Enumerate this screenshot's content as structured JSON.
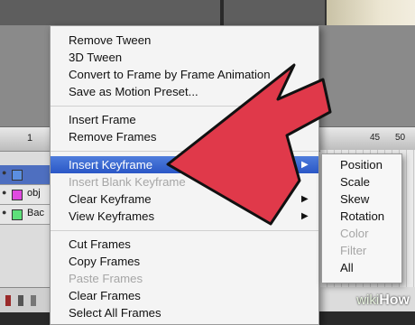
{
  "timeline": {
    "header_label": "1",
    "right_numbers": [
      "45",
      "50"
    ],
    "layers": [
      {
        "name": "",
        "color": "#5b8fe0",
        "selected": true
      },
      {
        "name": "obj",
        "color": "#e04ae0",
        "selected": false
      },
      {
        "name": "Bac",
        "color": "#5ee07a",
        "selected": false
      }
    ]
  },
  "context_menu": {
    "groups": [
      [
        {
          "label": "Remove Tween",
          "enabled": true
        },
        {
          "label": "3D Tween",
          "enabled": true
        },
        {
          "label": "Convert to Frame by Frame Animation",
          "enabled": true
        },
        {
          "label": "Save as Motion Preset...",
          "enabled": true
        }
      ],
      [
        {
          "label": "Insert Frame",
          "enabled": true
        },
        {
          "label": "Remove Frames",
          "enabled": true
        }
      ],
      [
        {
          "label": "Insert Keyframe",
          "enabled": true,
          "highlighted": true,
          "submenu": true
        },
        {
          "label": "Insert Blank Keyframe",
          "enabled": false
        },
        {
          "label": "Clear Keyframe",
          "enabled": true,
          "submenu": true
        },
        {
          "label": "View Keyframes",
          "enabled": true,
          "submenu": true
        }
      ],
      [
        {
          "label": "Cut Frames",
          "enabled": true
        },
        {
          "label": "Copy Frames",
          "enabled": true
        },
        {
          "label": "Paste Frames",
          "enabled": false
        },
        {
          "label": "Clear Frames",
          "enabled": true
        },
        {
          "label": "Select All Frames",
          "enabled": true
        }
      ]
    ],
    "submenu_arrow_icon": "triangle-right-icon"
  },
  "submenu": {
    "items": [
      {
        "label": "Position",
        "enabled": true
      },
      {
        "label": "Scale",
        "enabled": true
      },
      {
        "label": "Skew",
        "enabled": true
      },
      {
        "label": "Rotation",
        "enabled": true
      },
      {
        "label": "Color",
        "enabled": false
      },
      {
        "label": "Filter",
        "enabled": false
      },
      {
        "label": "All",
        "enabled": true
      }
    ]
  },
  "annotation": {
    "arrow_color": "#e0394a",
    "icon": "pointer-arrow-icon"
  },
  "watermark": {
    "part1": "wiki",
    "part2": "How"
  }
}
